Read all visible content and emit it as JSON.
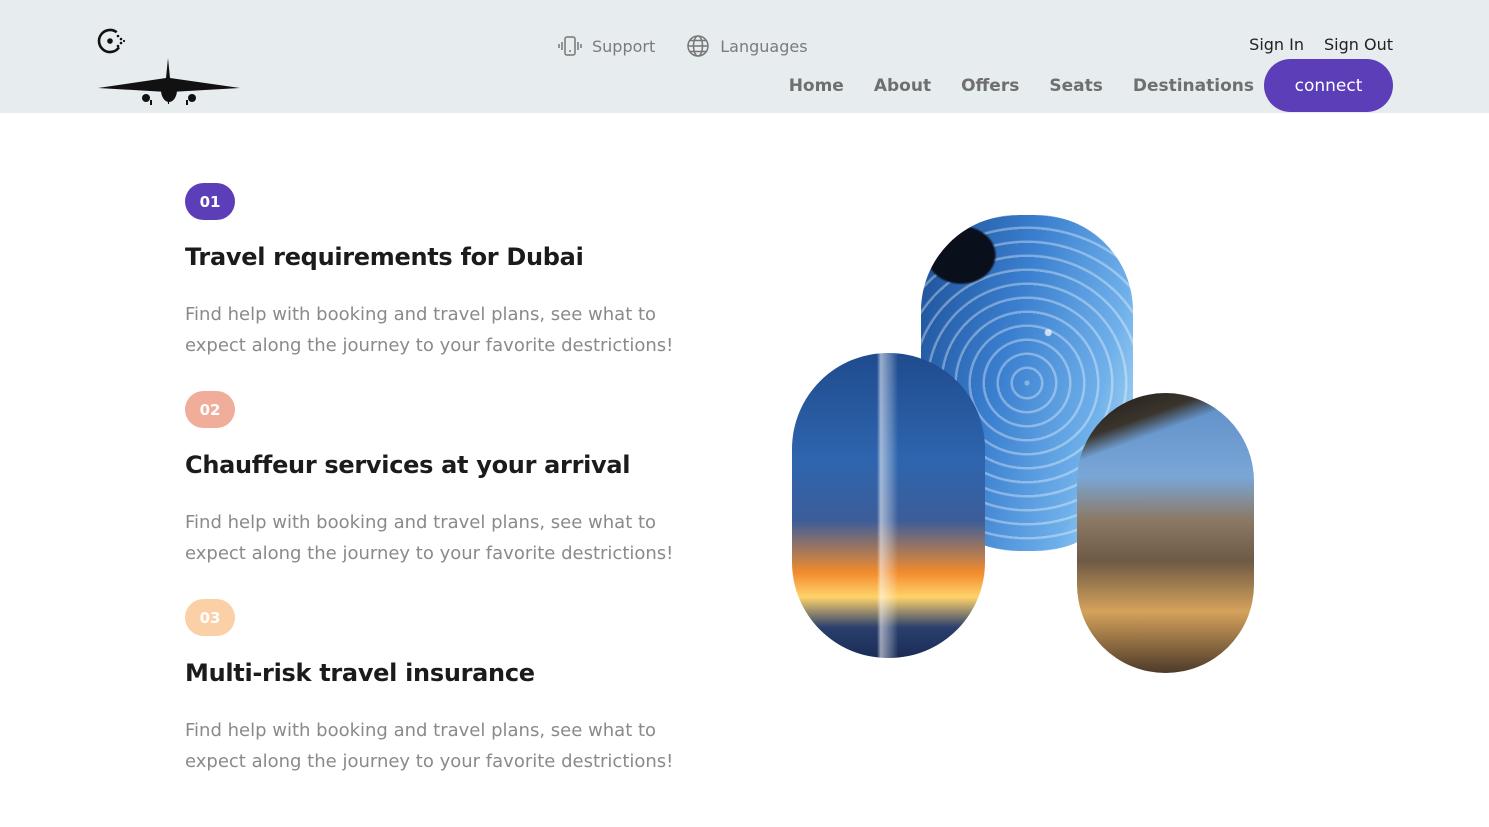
{
  "header": {
    "logo_icon": "airplane-logo-icon",
    "top_links": [
      {
        "label": "Support",
        "icon": "phone-vibrate-icon"
      },
      {
        "label": "Languages",
        "icon": "globe-icon"
      }
    ],
    "auth": {
      "sign_in": "Sign In",
      "sign_out": "Sign Out"
    },
    "nav": [
      "Home",
      "About",
      "Offers",
      "Seats",
      "Destinations"
    ],
    "connect_label": "connect"
  },
  "features": [
    {
      "number": "01",
      "title": "Travel requirements for Dubai",
      "description": "Find help with booking and travel plans, see what to expect along the journey to your favorite destrictions!",
      "badge_color": "#5c3fb8"
    },
    {
      "number": "02",
      "title": "Chauffeur services at your arrival",
      "description": "Find help with booking and travel plans, see what to expect along the journey to your favorite destrictions!",
      "badge_color": "#f0ad9a"
    },
    {
      "number": "03",
      "title": "Multi-risk travel insurance",
      "description": "Find help with booking and travel plans, see what to expect along the journey to your favorite destrictions!",
      "badge_color": "#fcd0a6"
    }
  ],
  "colors": {
    "accent": "#5c3fb8",
    "header_bg": "#e7ecef"
  }
}
